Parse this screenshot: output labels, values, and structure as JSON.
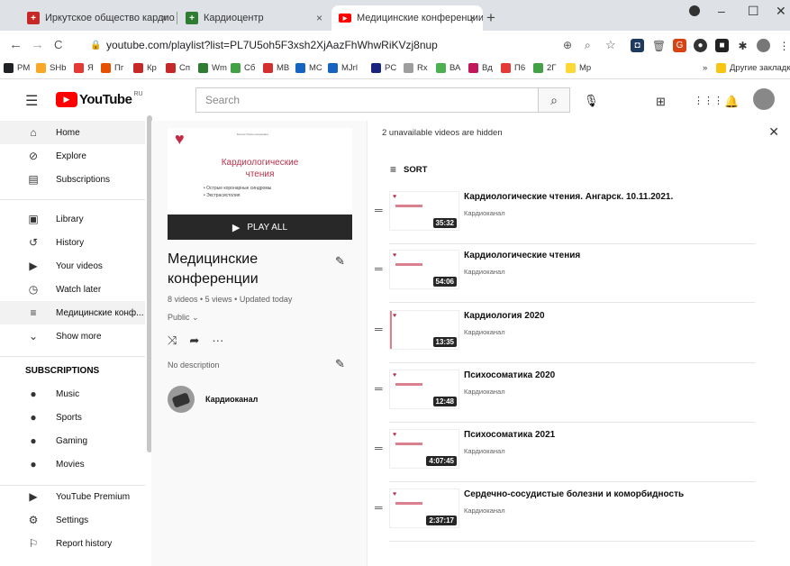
{
  "browser": {
    "tabs": [
      {
        "label": "Иркутское общество кардиоло",
        "close": "×"
      },
      {
        "label": "Кардиоцентр",
        "close": "×"
      },
      {
        "label": "Медицинские конференции - Y",
        "close": "×"
      }
    ],
    "new_tab": "+",
    "url": "youtube.com/playlist?list=PL7U5oh5F3xsh2XjAazFhWhwRiKVzj8nup",
    "bookmarks": [
      {
        "label": "PM",
        "color": "#202124"
      },
      {
        "label": "SHb",
        "color": "#f9a825"
      },
      {
        "label": "Я",
        "color": "#e53935"
      },
      {
        "label": "Пг",
        "color": "#e65100"
      },
      {
        "label": "Кр",
        "color": "#c62828"
      },
      {
        "label": "Сп",
        "color": "#c62828"
      },
      {
        "label": "Wm",
        "color": "#2e7d32"
      },
      {
        "label": "Сб",
        "color": "#43a047"
      },
      {
        "label": "МВ",
        "color": "#d32f2f"
      },
      {
        "label": "МС",
        "color": "#1565c0"
      },
      {
        "label": "MJrl",
        "color": "#1565c0"
      },
      {
        "label": "PC",
        "color": "#1a237e"
      },
      {
        "label": "Rx",
        "color": "#9e9e9e"
      },
      {
        "label": "ВА",
        "color": "#4caf50"
      },
      {
        "label": "Вд",
        "color": "#c2185b"
      },
      {
        "label": "П6",
        "color": "#e53935"
      },
      {
        "label": "2Г",
        "color": "#43a047"
      },
      {
        "label": "Мр",
        "color": "#fdd835"
      }
    ],
    "more_bookmarks": "»",
    "other_bookmarks": "Другие закладки"
  },
  "header": {
    "logo_text": "YouTube",
    "logo_region": "RU",
    "search_placeholder": "Search"
  },
  "sidebar": {
    "main": [
      {
        "label": "Home",
        "icon": "home-icon"
      },
      {
        "label": "Explore",
        "icon": "compass-icon"
      },
      {
        "label": "Subscriptions",
        "icon": "subscriptions-icon"
      }
    ],
    "library": [
      {
        "label": "Library",
        "icon": "library-icon"
      },
      {
        "label": "History",
        "icon": "history-icon"
      },
      {
        "label": "Your videos",
        "icon": "your-videos-icon"
      },
      {
        "label": "Watch later",
        "icon": "clock-icon"
      },
      {
        "label": "Медицинские конф...",
        "icon": "playlist-icon"
      },
      {
        "label": "Show more",
        "icon": "chevron-down-icon"
      }
    ],
    "subscriptions_heading": "SUBSCRIPTIONS",
    "subscriptions": [
      {
        "label": "Music"
      },
      {
        "label": "Sports"
      },
      {
        "label": "Gaming"
      },
      {
        "label": "Movies"
      }
    ],
    "more": [
      {
        "label": "YouTube Premium",
        "icon": "premium-icon"
      },
      {
        "label": "Settings",
        "icon": "gear-icon"
      },
      {
        "label": "Report history",
        "icon": "flag-icon"
      }
    ]
  },
  "playlist": {
    "thumb_title_line1": "Кардиологические",
    "thumb_title_line2": "чтения",
    "thumb_bullet1": "•  Острые коронарные синдромы",
    "thumb_bullet2": "•  Экстрасистолия",
    "thumb_small": "Бектас Раиса Ноэриевна",
    "play_all": "PLAY ALL",
    "title": "Медицинские конференции",
    "stats": "8 videos • 5 views • Updated today",
    "privacy": "Public",
    "description": "No description",
    "owner": "Кардиоканал"
  },
  "list": {
    "hidden_message": "2 unavailable videos are hidden",
    "sort_label": "SORT",
    "videos": [
      {
        "title": "Кардиологические чтения. Ангарск. 10.11.2021.",
        "channel": "Кардиоканал",
        "duration": "35:32"
      },
      {
        "title": "Кардиологические чтения",
        "channel": "Кардиоканал",
        "duration": "54:06"
      },
      {
        "title": "Кардиология 2020",
        "channel": "Кардиоканал",
        "duration": "13:35"
      },
      {
        "title": "Психосоматика 2020",
        "channel": "Кардиоканал",
        "duration": "12:48"
      },
      {
        "title": "Психосоматика 2021",
        "channel": "Кардиоканал",
        "duration": "4:07:45"
      },
      {
        "title": "Сердечно-сосудистые болезни и коморбидность",
        "channel": "Кардиоканал",
        "duration": "2:37:17"
      }
    ]
  }
}
